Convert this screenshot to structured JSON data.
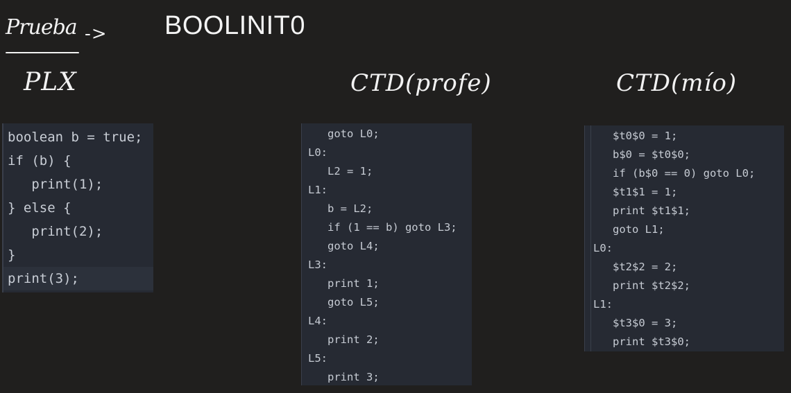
{
  "header": {
    "prueba_label": "Prueba",
    "arrow": "->",
    "title": "BOOLINIT0"
  },
  "columns": {
    "plx": {
      "label": "PLX",
      "code": [
        "boolean b = true;",
        "if (b) {",
        "   print(1);",
        "} else {",
        "   print(2);",
        "}",
        "print(3);"
      ]
    },
    "ctd_profe": {
      "label": "CTD(profe)",
      "code": [
        "   goto L0;",
        "L0:",
        "   L2 = 1;",
        "L1:",
        "   b = L2;",
        "   if (1 == b) goto L3;",
        "   goto L4;",
        "L3:",
        "   print 1;",
        "   goto L5;",
        "L4:",
        "   print 2;",
        "L5:",
        "   print 3;"
      ]
    },
    "ctd_mio": {
      "label": "CTD(mío)",
      "code": [
        "   $t0$0 = 1;",
        "   b$0 = $t0$0;",
        "   if (b$0 == 0) goto L0;",
        "   $t1$1 = 1;",
        "   print $t1$1;",
        "   goto L1;",
        "L0:",
        "   $t2$2 = 2;",
        "   print $t2$2;",
        "L1:",
        "   $t3$0 = 3;",
        "   print $t3$0;"
      ]
    }
  }
}
